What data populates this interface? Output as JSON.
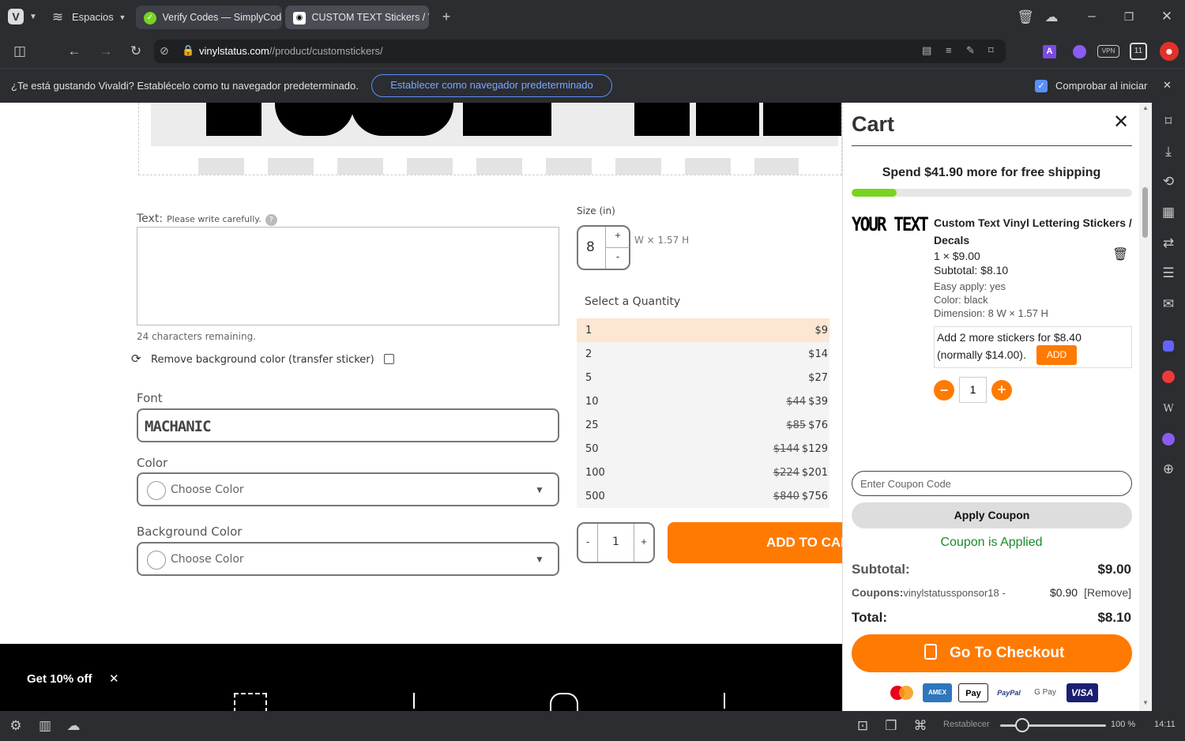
{
  "browser": {
    "workspaces_label": "Espacios",
    "tabs": [
      {
        "label": "Verify Codes — SimplyCodes"
      },
      {
        "label": "CUSTOM TEXT Stickers / Vinyl"
      }
    ],
    "url_domain": "vinylstatus.com",
    "url_path": "//product/customstickers/",
    "notification_text": "¿Te está gustando Vivaldi? Establécelo como tu navegador predeterminado.",
    "notification_button": "Establecer como navegador predeterminado",
    "notification_checkbox_label": "Comprobar al iniciar",
    "status_reset": "Restablecer",
    "zoom": "100 %",
    "clock": "14:11",
    "vpn_label": "VPN"
  },
  "product": {
    "text_label": "Text:",
    "text_hint": "Please write carefully.",
    "text_help": "?",
    "chars_remaining": "24 characters remaining.",
    "remove_bg_label": "Remove background color (transfer sticker)",
    "font_label": "Font",
    "font_value": "MACHANIC",
    "color_label": "Color",
    "color_placeholder": "Choose Color",
    "bg_color_label": "Background Color",
    "bg_color_placeholder": "Choose Color",
    "size_label": "Size (in)",
    "size_value": "8",
    "size_plus": "+",
    "size_minus": "-",
    "size_dims": "W × 1.57 H",
    "select_qty_label": "Select a Quantity",
    "quantities": [
      {
        "qty": "1",
        "old": "",
        "price": "$9"
      },
      {
        "qty": "2",
        "old": "",
        "price": "$14"
      },
      {
        "qty": "5",
        "old": "",
        "price": "$27"
      },
      {
        "qty": "10",
        "old": "$44",
        "price": "$39"
      },
      {
        "qty": "25",
        "old": "$85",
        "price": "$76"
      },
      {
        "qty": "50",
        "old": "$144",
        "price": "$129"
      },
      {
        "qty": "100",
        "old": "$224",
        "price": "$201"
      },
      {
        "qty": "500",
        "old": "$840",
        "price": "$756"
      }
    ],
    "qty_minus": "-",
    "qty_value": "1",
    "qty_plus": "+",
    "add_to_cart": "ADD TO CART",
    "promo_text": "Get 10% off",
    "promo_close": "✕"
  },
  "cart": {
    "title": "Cart",
    "shipping_msg": "Spend $41.90 more for free shipping",
    "shipping_progress": 0.16,
    "thumb_text": "YOUR TEXT",
    "item_name": "Custom Text Vinyl Lettering Stickers / Decals",
    "item_qty_price": "1 × $9.00",
    "item_subtotal": "Subtotal: $8.10",
    "attr_easy": "Easy apply: yes",
    "attr_color": "Color: black",
    "attr_dimension": "Dimension: 8 W × 1.57 H",
    "upsell_text": "Add 2 more stickers for $8.40 (normally $14.00).",
    "upsell_button": "ADD",
    "qty_value": "1",
    "coupon_placeholder": "Enter Coupon Code",
    "apply_coupon": "Apply Coupon",
    "coupon_applied": "Coupon is Applied",
    "subtotal_label": "Subtotal:",
    "subtotal_value": "$9.00",
    "coupons_label": "Coupons:",
    "coupon_code": "vinylstatussponsor18 -",
    "coupon_amount": "$0.90",
    "coupon_remove": "[Remove]",
    "total_label": "Total:",
    "total_value": "$8.10",
    "checkout": "Go To Checkout",
    "payments": [
      "AMEX",
      "Pay",
      "PayPal",
      "G Pay",
      "VISA"
    ]
  },
  "colors": {
    "accent_orange": "#ff7a00",
    "progress_green": "#7ad321",
    "coupon_green": "#1a8a2a",
    "link_blue": "#5b8ff9"
  }
}
